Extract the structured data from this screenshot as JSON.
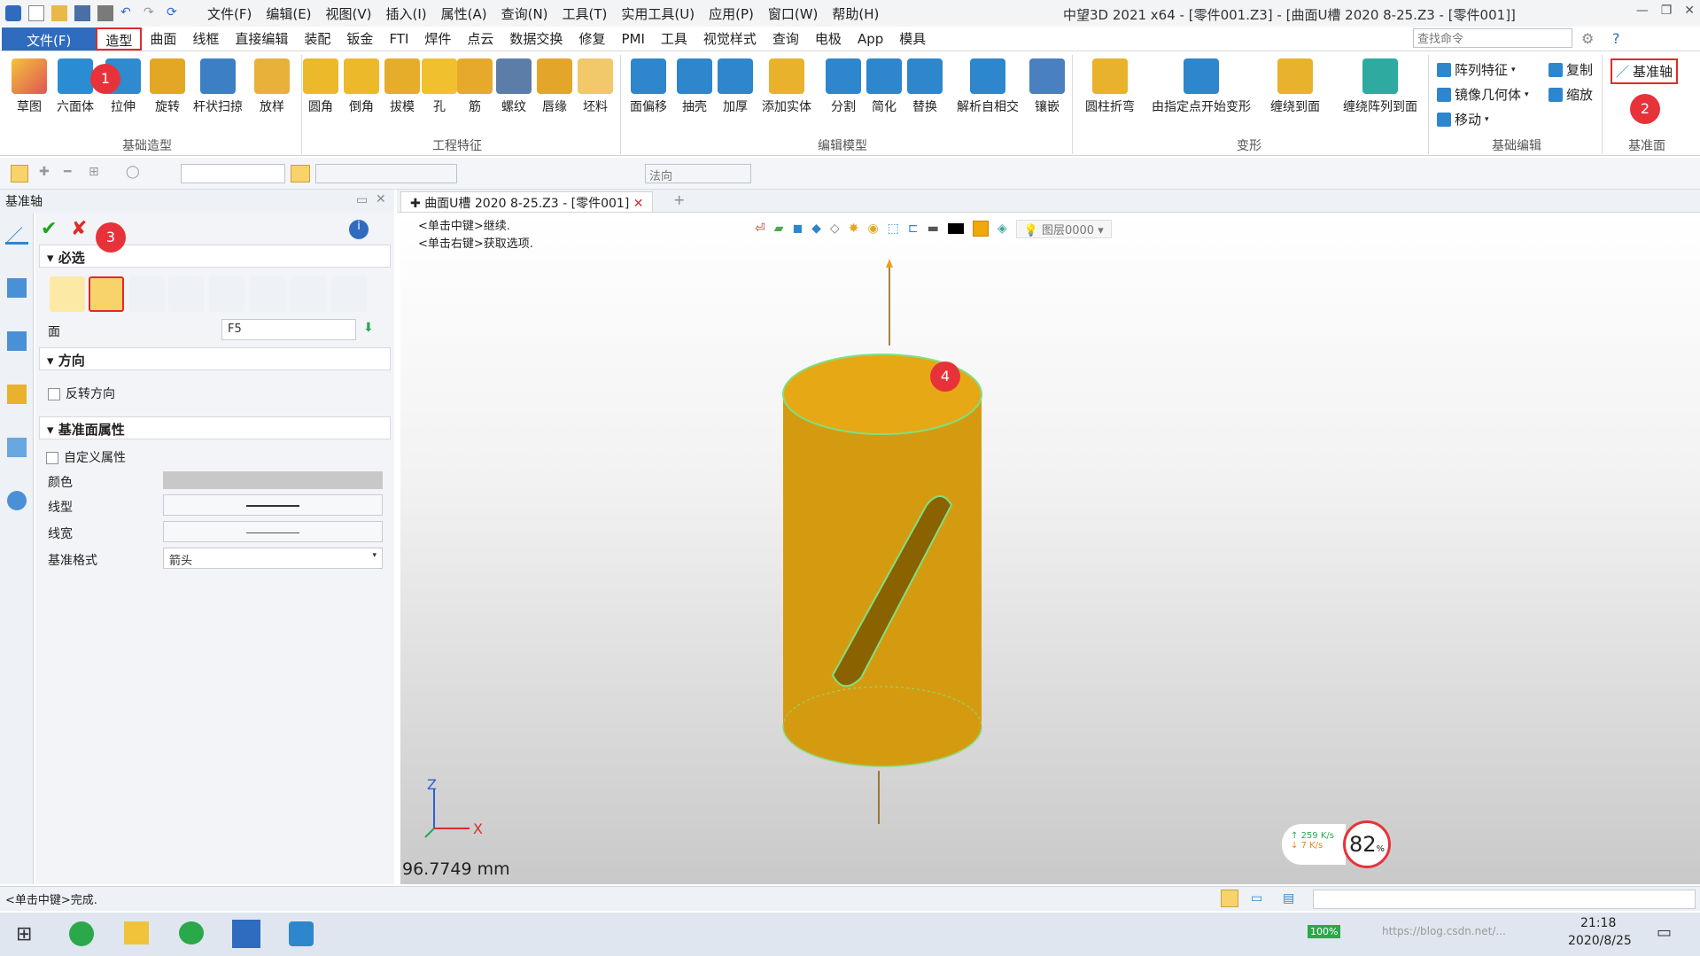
{
  "menu": {
    "items": [
      "文件(F)",
      "编辑(E)",
      "视图(V)",
      "插入(I)",
      "属性(A)",
      "查询(N)",
      "工具(T)",
      "实用工具(U)",
      "应用(P)",
      "窗口(W)",
      "帮助(H)"
    ],
    "window_title": "中望3D 2021 x64 - [零件001.Z3] - [曲面U槽 2020 8-25.Z3 - [零件001]]"
  },
  "tabs": [
    "文件(F)",
    "造型",
    "曲面",
    "线框",
    "直接编辑",
    "装配",
    "钣金",
    "FTI",
    "焊件",
    "点云",
    "数据交换",
    "修复",
    "PMI",
    "工具",
    "视觉样式",
    "查询",
    "电极",
    "App",
    "模具"
  ],
  "search": {
    "placeholder": "查找命令"
  },
  "ribbon": {
    "groups": {
      "basic_modeling": {
        "label": "基础造型",
        "buttons": [
          "草图",
          "六面体",
          "拉伸",
          "旋转",
          "杆状扫掠",
          "放样"
        ]
      },
      "eng_features": {
        "label": "工程特征",
        "buttons": [
          "圆角",
          "倒角",
          "拔模",
          "孔",
          "筋",
          "螺纹",
          "唇缘",
          "坯料"
        ]
      },
      "edit_model": {
        "label": "编辑模型",
        "buttons": [
          "面偏移",
          "抽壳",
          "加厚",
          "添加实体",
          "分割",
          "简化",
          "替换",
          "解析自相交",
          "镶嵌"
        ]
      },
      "deform": {
        "label": "变形",
        "buttons": [
          "圆柱折弯",
          "由指定点开始变形",
          "缠绕到面",
          "缠绕阵列到面"
        ]
      },
      "basic_edit": {
        "label": "基础编辑",
        "items": [
          "阵列特征",
          "镜像几何体",
          "移动",
          "复制",
          "缩放"
        ]
      },
      "datum": {
        "label": "基准面",
        "item": "基准轴"
      }
    }
  },
  "toolbar2": {
    "direction_placeholder": "法向"
  },
  "panel": {
    "title": "基准轴",
    "required_label": "必选",
    "face_label": "面",
    "face_value": "F5",
    "direction_label": "方向",
    "reverse_label": "反转方向",
    "props_label": "基准面属性",
    "custom_label": "自定义属性",
    "color_label": "颜色",
    "linetype_label": "线型",
    "linewidth_label": "线宽",
    "format_label": "基准格式",
    "format_value": "箭头"
  },
  "doc_tab": "曲面U槽 2020 8-25.Z3 - [零件001]",
  "viewport": {
    "hint1": "<单击中键>继续.",
    "hint2": "<单击右键>获取选项.",
    "layer": "图层0000",
    "measure": "96.7749 mm",
    "axis_x": "X",
    "axis_z": "Z",
    "net_up": "259 K/s",
    "net_down": "7  K/s",
    "cpu": "82",
    "cpu_unit": "%"
  },
  "status": {
    "text": "<单击中键>完成."
  },
  "taskbar": {
    "time": "21:18",
    "date": "2020/8/25",
    "battery": "100%",
    "watermark": "https://blog.csdn.net/..."
  },
  "badges": [
    "1",
    "2",
    "3",
    "4"
  ],
  "colors": {
    "accent": "#2f6bbf",
    "highlight": "#e02a2a",
    "cylinder": "#e0a612",
    "edge": "#7fe07f"
  }
}
